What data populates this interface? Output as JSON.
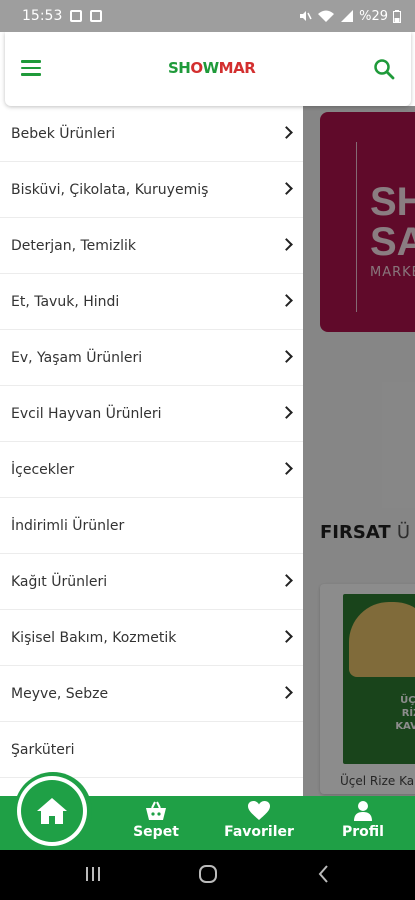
{
  "status_bar": {
    "time": "15:53",
    "battery": "%29"
  },
  "header": {
    "logo_part1": "SH",
    "logo_part2": "O",
    "logo_part3": "W",
    "logo_part4": "MAR"
  },
  "drawer": {
    "categories": [
      {
        "label": "Bebek Ürünleri",
        "has_children": true
      },
      {
        "label": "Bisküvi, Çikolata, Kuruyemiş",
        "has_children": true
      },
      {
        "label": "Deterjan, Temizlik",
        "has_children": true
      },
      {
        "label": "Et, Tavuk, Hindi",
        "has_children": true
      },
      {
        "label": "Ev, Yaşam Ürünleri",
        "has_children": true
      },
      {
        "label": "Evcil Hayvan Ürünleri",
        "has_children": true
      },
      {
        "label": "İçecekler",
        "has_children": true
      },
      {
        "label": "İndirimli Ürünler",
        "has_children": false
      },
      {
        "label": "Kağıt Ürünleri",
        "has_children": true
      },
      {
        "label": "Kişisel Bakım, Kozmetik",
        "has_children": true
      },
      {
        "label": "Meyve, Sebze",
        "has_children": true
      },
      {
        "label": "Şarküteri",
        "has_children": false
      }
    ]
  },
  "background": {
    "banner_line1": "SHO",
    "banner_line2": "SAN",
    "banner_line3": "MARKET",
    "section_title_bold": "FIRSAT",
    "section_title_rest": "Ü",
    "product_name": "Üçel Rize Ka",
    "product_image_text": "ÜÇEL RİZE KAVUR"
  },
  "bottom_nav": {
    "cart_label": "Sepet",
    "favorites_label": "Favoriler",
    "profile_label": "Profil"
  },
  "colors": {
    "brand_green": "#1fa046",
    "brand_red": "#d32f2f",
    "banner": "#b0134e"
  }
}
